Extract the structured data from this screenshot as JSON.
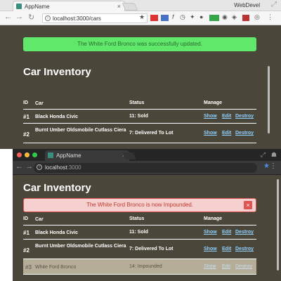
{
  "top_window": {
    "tab_title": "AppName",
    "profile_name": "WebDevel",
    "url": "localhost:3000/cars",
    "flash_success": "The White Ford Bronco was successfully updated.",
    "heading": "Car Inventory",
    "table": {
      "headers": {
        "id": "ID",
        "car": "Car",
        "status": "Status",
        "manage": "Manage"
      },
      "rows": [
        {
          "id": "#1",
          "car": "Black Honda Civic",
          "status": "11: Sold",
          "show": "Show",
          "edit": "Edit",
          "destroy": "Destroy"
        },
        {
          "id": "#2",
          "car": "Burnt Umber Oldsmobile Cutlass Ciera",
          "status": "7: Delivered To Lot",
          "show": "Show",
          "edit": "Edit",
          "destroy": "Destroy"
        }
      ]
    }
  },
  "bottom_window": {
    "tab_title": "AppName",
    "url_host": "localhost",
    "url_port": ":3000",
    "heading": "Car Inventory",
    "flash_danger": "The White Ford Bronco is now Impounded.",
    "table": {
      "headers": {
        "id": "ID",
        "car": "Car",
        "status": "Status",
        "manage": "Manage"
      },
      "rows": [
        {
          "id": "#1",
          "car": "Black Honda Civic",
          "status": "11: Sold",
          "show": "Show",
          "edit": "Edit",
          "destroy": "Destroy"
        },
        {
          "id": "#2",
          "car": "Burnt Umber Oldsmobile Cutlass Ciera",
          "status": "7: Delivered To Lot",
          "show": "Show",
          "edit": "Edit",
          "destroy": "Destroy"
        },
        {
          "id": "#3",
          "car": "White Ford Bronco",
          "status": "14: Impounded",
          "show": "Show",
          "edit": "Edit",
          "destroy": "Destroy"
        }
      ]
    }
  },
  "icons": {
    "close": "×",
    "back": "←",
    "forward": "→",
    "reload": "↻",
    "star": "★",
    "menu": "⋮",
    "expand": "⤢",
    "info": "i",
    "flash_close": "×"
  },
  "colors": {
    "page_bg": "#4a4639",
    "success_bg": "#5fe86a",
    "danger_bg": "#f6d0d0",
    "danger_border": "#e05353",
    "link": "#8fd0ff",
    "highlight_row": "#b5ad98"
  }
}
